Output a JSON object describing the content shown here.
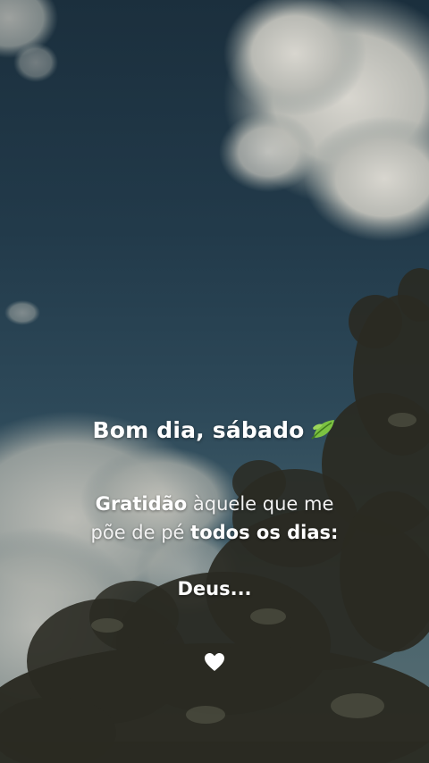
{
  "story": {
    "title": "Bom dia, sábado",
    "title_emoji_icon": "leaf-icon",
    "line1_bold": "Gratidão",
    "line1_light": "àquele que me",
    "line2_light": "põe de pé",
    "line2_bold": "todos os dias:",
    "closing": "Deus...",
    "footer_icon": "heart-icon"
  },
  "colors": {
    "sky_top": "#1b2f3d",
    "text": "#ffffff",
    "leaf_green": "#7cc242"
  }
}
